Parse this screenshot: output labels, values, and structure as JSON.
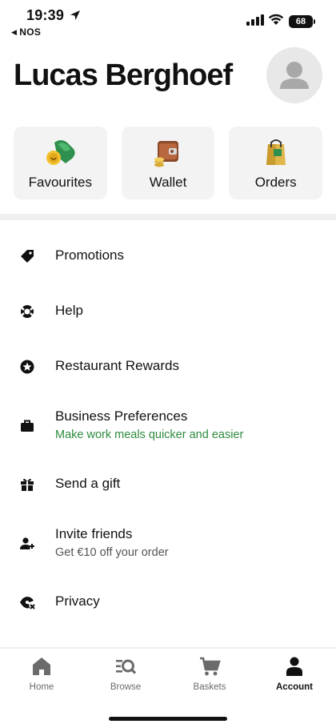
{
  "status_bar": {
    "time": "19:39",
    "back_app": "NOS",
    "battery": "68"
  },
  "header": {
    "user_name": "Lucas Berghoef"
  },
  "tiles": [
    {
      "label": "Favourites",
      "icon": "favourites-icon"
    },
    {
      "label": "Wallet",
      "icon": "wallet-icon"
    },
    {
      "label": "Orders",
      "icon": "orders-icon"
    }
  ],
  "menu": [
    {
      "label": "Promotions",
      "icon": "tag-icon"
    },
    {
      "label": "Help",
      "icon": "lifebuoy-icon"
    },
    {
      "label": "Restaurant Rewards",
      "icon": "star-badge-icon"
    },
    {
      "label": "Business Preferences",
      "sub": "Make work meals quicker and easier",
      "icon": "briefcase-icon"
    },
    {
      "label": "Send a gift",
      "icon": "gift-icon"
    },
    {
      "label": "Invite friends",
      "sub": "Get €10 off your order",
      "icon": "add-person-icon"
    },
    {
      "label": "Privacy",
      "icon": "privacy-eye-icon"
    }
  ],
  "bottom_nav": [
    {
      "label": "Home",
      "icon": "home-icon"
    },
    {
      "label": "Browse",
      "icon": "browse-icon"
    },
    {
      "label": "Baskets",
      "icon": "basket-icon"
    },
    {
      "label": "Account",
      "icon": "account-icon",
      "active": true
    }
  ],
  "colors": {
    "accent_green": "#2e8b3e",
    "tile_bg": "#f3f3f3",
    "text": "#111111"
  }
}
